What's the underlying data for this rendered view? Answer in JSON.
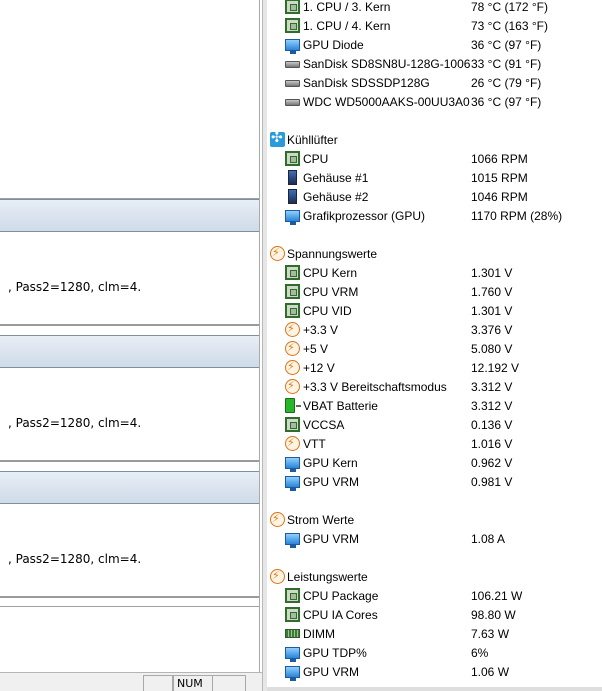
{
  "left": {
    "message_lines": [
      ", Pass2=1280, clm=4.",
      ", Pass2=1280, clm=4.",
      ", Pass2=1280, clm=4."
    ],
    "statusbar": {
      "num": "NUM"
    }
  },
  "sensors": [
    {
      "kind": "item",
      "icon": "chip-icon",
      "label": "1. CPU / 3. Kern",
      "value": "78 °C  (172 °F)"
    },
    {
      "kind": "item",
      "icon": "chip-icon",
      "label": "1. CPU / 4. Kern",
      "value": "73 °C  (163 °F)"
    },
    {
      "kind": "item",
      "icon": "gpu-icon",
      "label": "GPU Diode",
      "value": "36 °C  (97 °F)"
    },
    {
      "kind": "item",
      "icon": "disk-icon",
      "label": "SanDisk SD8SN8U-128G-1006",
      "value": "33 °C  (91 °F)"
    },
    {
      "kind": "item",
      "icon": "disk-icon",
      "label": "SanDisk SDSSDP128G",
      "value": "26 °C  (79 °F)"
    },
    {
      "kind": "item",
      "icon": "disk-icon",
      "label": "WDC WD5000AAKS-00UU3A0",
      "value": "36 °C  (97 °F)"
    },
    {
      "kind": "group",
      "icon": "fan-icon",
      "label": "Kühllüfter",
      "value": ""
    },
    {
      "kind": "item",
      "icon": "chip-icon",
      "label": "CPU",
      "value": "1066 RPM"
    },
    {
      "kind": "item",
      "icon": "case-icon",
      "label": "Gehäuse #1",
      "value": "1015 RPM"
    },
    {
      "kind": "item",
      "icon": "case-icon",
      "label": "Gehäuse #2",
      "value": "1046 RPM"
    },
    {
      "kind": "item",
      "icon": "gpu-icon",
      "label": "Grafikprozessor (GPU)",
      "value": "1170 RPM  (28%)"
    },
    {
      "kind": "group",
      "icon": "bolt-icon",
      "label": "Spannungswerte",
      "value": ""
    },
    {
      "kind": "item",
      "icon": "chip-icon",
      "label": "CPU Kern",
      "value": "1.301 V"
    },
    {
      "kind": "item",
      "icon": "chip-icon",
      "label": "CPU VRM",
      "value": "1.760 V"
    },
    {
      "kind": "item",
      "icon": "chip-icon",
      "label": "CPU VID",
      "value": "1.301 V"
    },
    {
      "kind": "item",
      "icon": "bolt-icon",
      "label": "+3.3 V",
      "value": "3.376 V"
    },
    {
      "kind": "item",
      "icon": "bolt-icon",
      "label": "+5 V",
      "value": "5.080 V"
    },
    {
      "kind": "item",
      "icon": "bolt-icon",
      "label": "+12 V",
      "value": "12.192 V"
    },
    {
      "kind": "item",
      "icon": "bolt-icon",
      "label": "+3.3 V Bereitschaftsmodus",
      "value": "3.312 V"
    },
    {
      "kind": "item",
      "icon": "battery-icon",
      "label": "VBAT Batterie",
      "value": "3.312 V"
    },
    {
      "kind": "item",
      "icon": "chip-icon",
      "label": "VCCSA",
      "value": "0.136 V"
    },
    {
      "kind": "item",
      "icon": "bolt-icon",
      "label": "VTT",
      "value": "1.016 V"
    },
    {
      "kind": "item",
      "icon": "gpu-icon",
      "label": "GPU Kern",
      "value": "0.962 V"
    },
    {
      "kind": "item",
      "icon": "gpu-icon",
      "label": "GPU VRM",
      "value": "0.981 V"
    },
    {
      "kind": "group",
      "icon": "bolt-icon",
      "label": "Strom Werte",
      "value": ""
    },
    {
      "kind": "item",
      "icon": "gpu-icon",
      "label": "GPU VRM",
      "value": "1.08 A"
    },
    {
      "kind": "group",
      "icon": "bolt-icon",
      "label": "Leistungswerte",
      "value": ""
    },
    {
      "kind": "item",
      "icon": "chip-icon",
      "label": "CPU Package",
      "value": "106.21 W"
    },
    {
      "kind": "item",
      "icon": "chip-icon",
      "label": "CPU IA Cores",
      "value": "98.80 W"
    },
    {
      "kind": "item",
      "icon": "ram-icon",
      "label": "DIMM",
      "value": "7.63 W"
    },
    {
      "kind": "item",
      "icon": "gpu-icon",
      "label": "GPU TDP%",
      "value": "6%"
    },
    {
      "kind": "item",
      "icon": "gpu-icon",
      "label": "GPU VRM",
      "value": "1.06 W"
    }
  ]
}
